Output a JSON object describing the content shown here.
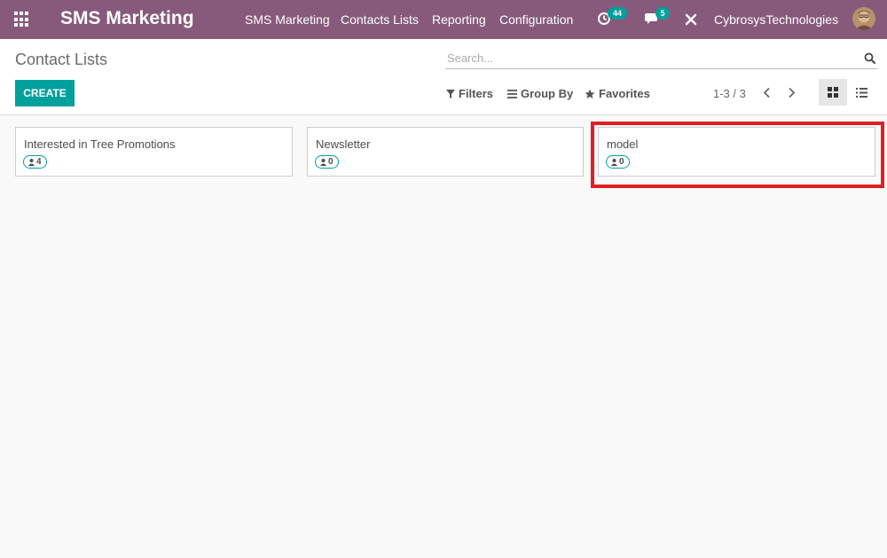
{
  "app": {
    "title": "SMS Marketing",
    "menu": [
      "SMS Marketing",
      "Contacts Lists",
      "Reporting",
      "Configuration"
    ],
    "activities_count": "44",
    "messages_count": "5",
    "company": "CybrosysTechnologies"
  },
  "control": {
    "breadcrumb": "Contact Lists",
    "search_placeholder": "Search...",
    "create_label": "CREATE",
    "filters_label": "Filters",
    "groupby_label": "Group By",
    "favorites_label": "Favorites",
    "pager": "1-3 / 3"
  },
  "cards": [
    {
      "name": "Interested in Tree Promotions",
      "contacts": "4"
    },
    {
      "name": "Newsletter",
      "contacts": "0"
    },
    {
      "name": "model",
      "contacts": "0"
    }
  ],
  "colors": {
    "navbar": "#875a7b",
    "accent": "#00a09d",
    "highlight": "#e01e26"
  }
}
